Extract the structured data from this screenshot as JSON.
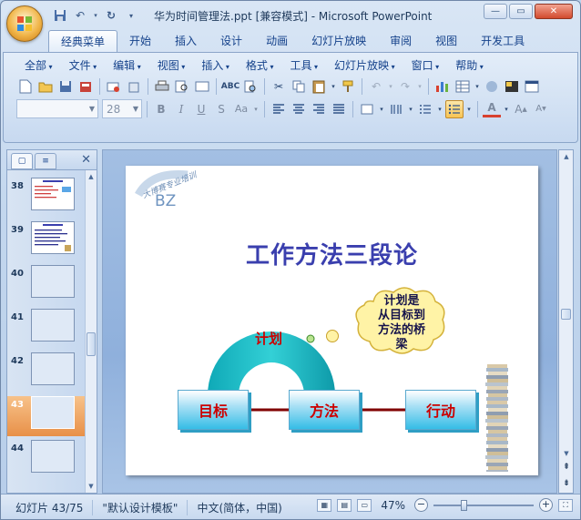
{
  "window": {
    "title": "华为时间管理法.ppt [兼容模式] - Microsoft PowerPoint",
    "controls": {
      "minimize": "—",
      "maximize": "▭",
      "close": "✕"
    }
  },
  "quick_access": [
    "save-icon",
    "undo-icon",
    "redo-icon",
    "customize-icon"
  ],
  "tabs": [
    {
      "label": "经典菜单",
      "active": true
    },
    {
      "label": "开始"
    },
    {
      "label": "插入"
    },
    {
      "label": "设计"
    },
    {
      "label": "动画"
    },
    {
      "label": "幻灯片放映"
    },
    {
      "label": "审阅"
    },
    {
      "label": "视图"
    },
    {
      "label": "开发工具"
    }
  ],
  "menubar": [
    "全部",
    "文件",
    "编辑",
    "视图",
    "插入",
    "格式",
    "工具",
    "幻灯片放映",
    "窗口",
    "帮助"
  ],
  "format_toolbar": {
    "font_name": "",
    "font_size": "28"
  },
  "slides_panel": {
    "tabs": [
      "slides-tab-icon",
      "outline-tab-icon"
    ],
    "items": [
      {
        "num": "38",
        "kind": "text"
      },
      {
        "num": "39",
        "kind": "text"
      },
      {
        "num": "40",
        "kind": "blank"
      },
      {
        "num": "41",
        "kind": "blank"
      },
      {
        "num": "42",
        "kind": "blank"
      },
      {
        "num": "43",
        "kind": "blank",
        "selected": true
      },
      {
        "num": "44",
        "kind": "blank"
      }
    ]
  },
  "slide": {
    "logo_text": "BZ",
    "logo_arc_text": "大博赛专业培训",
    "title": "工作方法三段论",
    "boxes": [
      "目标",
      "方法",
      "行动"
    ],
    "arc_label": "计划",
    "cloud_text": [
      "计划是",
      "从目标到",
      "方法的桥",
      "梁"
    ],
    "colors": {
      "title": "#3a3fae",
      "box_text": "#cc0000",
      "arc": "#16b6c0",
      "connector": "#800000",
      "cloud": "#fff3a6"
    }
  },
  "status": {
    "slide_counter": "幻灯片 43/75",
    "template": "\"默认设计模板\"",
    "language": "中文(简体，中国)",
    "zoom": "47%",
    "zoom_fraction": 0.47
  }
}
